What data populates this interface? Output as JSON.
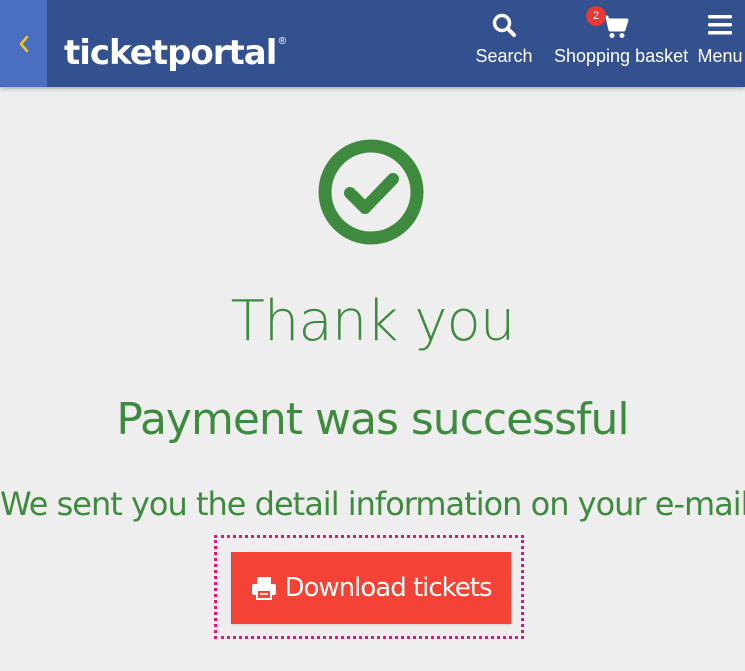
{
  "header": {
    "logo_text": "ticketportal",
    "logo_mark": "®",
    "back_icon": "chevron-left-icon",
    "nav": {
      "search": {
        "label": "Search",
        "icon": "search-icon"
      },
      "basket": {
        "label": "Shopping basket",
        "icon": "shopping-cart-icon",
        "badge_count": "2"
      },
      "menu": {
        "label": "Menu",
        "icon": "hamburger-menu-icon"
      }
    }
  },
  "main": {
    "status_icon": "check-circle-icon",
    "title": "Thank you",
    "subtitle": "Payment was successful",
    "info": "We sent you the detail information on your e-mail",
    "download_button": {
      "label": "Download tickets",
      "icon": "printer-icon"
    }
  },
  "colors": {
    "header_bg": "#33508f",
    "back_bg": "#4a6fc0",
    "accent_yellow": "#f5c518",
    "success_green": "#3e8a3e",
    "button_red": "#f44336",
    "badge_red": "#e53935",
    "focus_ring": "#d81b7a",
    "page_bg": "#eeeeee"
  }
}
